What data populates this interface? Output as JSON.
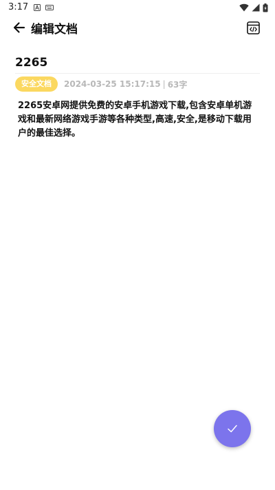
{
  "status_bar": {
    "time": "3:17"
  },
  "header": {
    "title": "编辑文档",
    "back_icon": "arrow-left-icon",
    "code_icon": "code-view-icon"
  },
  "document": {
    "title": "2265",
    "category": "安全文档",
    "timestamp": "2024-03-25 15:17:15",
    "separator": "|",
    "char_count": "63字",
    "body": "2265安卓网提供免费的安卓手机游戏下载,包含安卓单机游戏和最新网络游戏手游等各种类型,高速,安全,是移动下载用户的最佳选择。"
  },
  "fab": {
    "icon": "check-icon"
  },
  "colors": {
    "badge": "#fbd860",
    "fab": "#7c74ec",
    "meta_text": "#b8b8b8"
  }
}
